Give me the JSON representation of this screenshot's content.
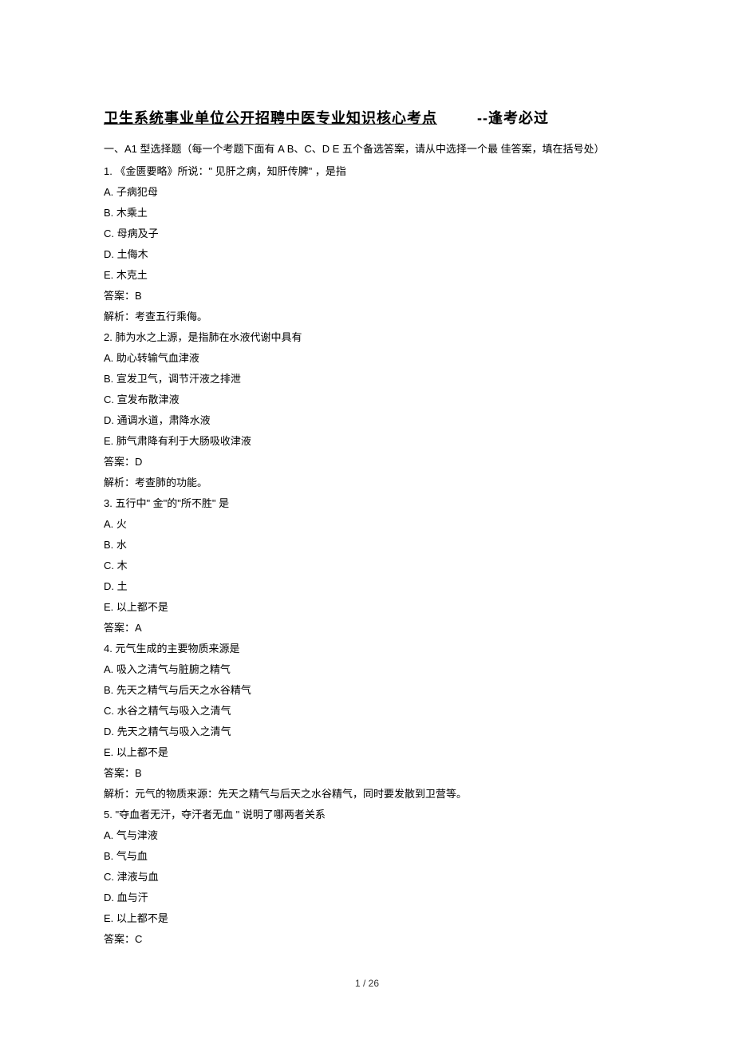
{
  "title_part1": "卫生系统事业单位公开招聘中医专业知识核心考点",
  "title_part2": "--逢考必过",
  "instruction": "一、A1 型选择题（每一个考题下面有 A B、C、D E 五个备选答案，请从中选择一个最 佳答案，填在括号处）",
  "questions": [
    {
      "num": "1.",
      "text": "《金匮要略》所说：\" 见肝之病，知肝传脾\" ，是指",
      "options": [
        "A.  子病犯母",
        "B.  木乘土",
        "C.  母病及子",
        "D.  土侮木",
        "E.  木克土"
      ],
      "answer": "答案：B",
      "analysis": "解析：考查五行乘侮。"
    },
    {
      "num": "2.",
      "text": "肺为水之上源，是指肺在水液代谢中具有",
      "options": [
        "A.  助心转输气血津液",
        "B.  宣发卫气，调节汗液之排泄",
        "C.  宣发布散津液",
        "D.  通调水道，肃降水液",
        "E.  肺气肃降有利于大肠吸收津液"
      ],
      "answer": "答案：D",
      "analysis": "解析：考查肺的功能。"
    },
    {
      "num": "3.",
      "text": "五行中\" 金\"的\"所不胜\" 是",
      "options": [
        "A.  火",
        "B.  水",
        "C.  木",
        "D.  土",
        "E.  以上都不是"
      ],
      "answer": "答案：A",
      "analysis": ""
    },
    {
      "num": "4.",
      "text": "元气生成的主要物质来源是",
      "options": [
        "A.  吸入之清气与脏腑之精气",
        "B.  先天之精气与后天之水谷精气",
        "C.  水谷之精气与吸入之清气",
        "D.  先天之精气与吸入之清气",
        "E.  以上都不是"
      ],
      "answer": "答案：B",
      "analysis": "解析：元气的物质来源：先天之精气与后天之水谷精气，同时要发散到卫营等。"
    },
    {
      "num": "5.",
      "text": "\"夺血者无汗，夺汗者无血 \" 说明了哪两者关系",
      "options": [
        "A.  气与津液",
        "B.  气与血",
        "C.  津液与血",
        "D.  血与汗",
        "E.  以上都不是"
      ],
      "answer": "答案：C",
      "analysis": ""
    }
  ],
  "page_number": "1 / 26"
}
